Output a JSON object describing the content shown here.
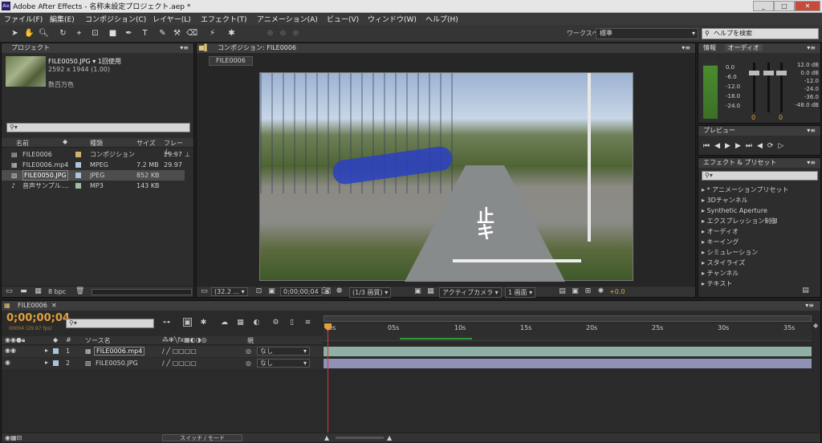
{
  "window": {
    "title": "Adobe After Effects - 名称未設定プロジェクト.aep *",
    "app_icon": "Ae",
    "min": "_",
    "max": "□",
    "close": "✕"
  },
  "menu": [
    "ファイル(F)",
    "編集(E)",
    "コンポジション(C)",
    "レイヤー(L)",
    "エフェクト(T)",
    "アニメーション(A)",
    "ビュー(V)",
    "ウィンドウ(W)",
    "ヘルプ(H)"
  ],
  "toolbar": {
    "workspace_label": "ワークスペース :",
    "workspace_value": "標準",
    "help_search": "ヘルプを検索"
  },
  "project": {
    "tab": "プロジェクト",
    "selected_name": "FILE0050.JPG ▾ 1回使用",
    "selected_size": "2592 x 1944 (1.00)",
    "selected_color": "数百万色",
    "columns": [
      "名前",
      "種類",
      "サイズ",
      "フレーム..."
    ],
    "items": [
      {
        "name": "FILE0006",
        "type": "コンポジション",
        "size": "",
        "frames": "29.97",
        "color": "#d1b36c",
        "icon": "composition-icon"
      },
      {
        "name": "FILE0006.mp4",
        "type": "MPEG",
        "size": "7.2 MB",
        "frames": "29.97",
        "color": "#a9c4de",
        "icon": "video-file-icon"
      },
      {
        "name": "FILE0050.JPG",
        "type": "JPEG",
        "size": "852 KB",
        "frames": "",
        "color": "#a9c4de",
        "icon": "image-file-icon"
      },
      {
        "name": "音声サンプル....",
        "type": "MP3",
        "size": "143 KB",
        "frames": "",
        "color": "#9fbfa0",
        "icon": "audio-file-icon"
      }
    ],
    "bpc": "8 bpc"
  },
  "comp": {
    "tab": "コンポジション: FILE0006",
    "subtab": "FILE0006",
    "zoom": "(32.2 ...",
    "timecode": "0;00;00;04",
    "resolution": "(1/3 画質)",
    "camera": "アクティブカメラ",
    "views": "1 画面",
    "exposure": "+0.0"
  },
  "info": {
    "tab1": "情報",
    "tab2": "オーディオ",
    "db_left": [
      "0.0",
      "-6.0",
      "-12.0",
      "-18.0",
      "-24.0"
    ],
    "db_right": [
      "12.0 dB",
      "0.0 dB",
      "-12.0",
      "-24.0",
      "-36.0",
      "-48.0 dB"
    ],
    "knob1": "0",
    "knob2": "0"
  },
  "preview": {
    "tab": "プレビュー"
  },
  "effects": {
    "tab": "エフェクト & プリセット",
    "items": [
      "* アニメーションプリセット",
      "3Dチャンネル",
      "Synthetic Aperture",
      "エクスプレッション制御",
      "オーディオ",
      "キーイング",
      "シミュレーション",
      "スタイライズ",
      "チャンネル",
      "テキスト"
    ]
  },
  "timeline": {
    "tab": "FILE0006",
    "timecode": "0;00;00;04",
    "fps": "00004 (29.97 fps)",
    "col_source": "ソース名",
    "col_parent": "親",
    "ruler": [
      "0s",
      "05s",
      "10s",
      "15s",
      "20s",
      "25s",
      "30s",
      "35s"
    ],
    "layers": [
      {
        "num": "1",
        "name": "FILE0006.mp4",
        "parent": "なし",
        "color": "#a9c4de"
      },
      {
        "num": "2",
        "name": "FILE0050.JPG",
        "parent": "なし",
        "color": "#a9c4de"
      }
    ],
    "toggle": "スイッチ / モード"
  }
}
